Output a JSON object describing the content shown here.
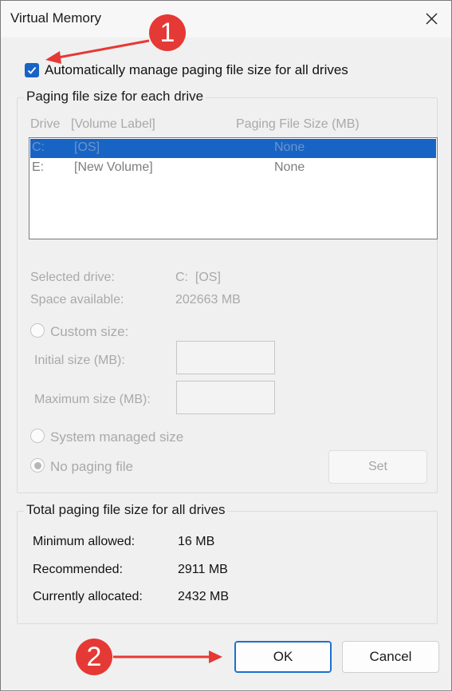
{
  "window": {
    "title": "Virtual Memory"
  },
  "auto_manage": {
    "label": "Automatically manage paging file size for all drives",
    "checked": true
  },
  "paging_group": {
    "title": "Paging file size for each drive",
    "col_drive": "Drive",
    "col_label": "[Volume Label]",
    "col_size": "Paging File Size (MB)",
    "drives": [
      {
        "drive": "C:",
        "label": "[OS]",
        "size": "None",
        "selected": true
      },
      {
        "drive": "E:",
        "label": "[New Volume]",
        "size": "None",
        "selected": false
      }
    ],
    "selected_drive_label": "Selected drive:",
    "selected_drive_value": "C:  [OS]",
    "space_label": "Space available:",
    "space_value": "202663 MB",
    "custom_size_label": "Custom size:",
    "initial_size_label": "Initial size (MB):",
    "initial_size_value": "",
    "maximum_size_label": "Maximum size (MB):",
    "maximum_size_value": "",
    "system_managed_label": "System managed size",
    "no_paging_label": "No paging file",
    "selected_option": "No paging file",
    "set_label": "Set"
  },
  "totals_group": {
    "title": "Total paging file size for all drives",
    "min_label": "Minimum allowed:",
    "min_value": "16 MB",
    "rec_label": "Recommended:",
    "rec_value": "2911 MB",
    "cur_label": "Currently allocated:",
    "cur_value": "2432 MB"
  },
  "buttons": {
    "ok": "OK",
    "cancel": "Cancel"
  },
  "annotations": {
    "step1": "1",
    "step2": "2",
    "color": "#e53935"
  }
}
